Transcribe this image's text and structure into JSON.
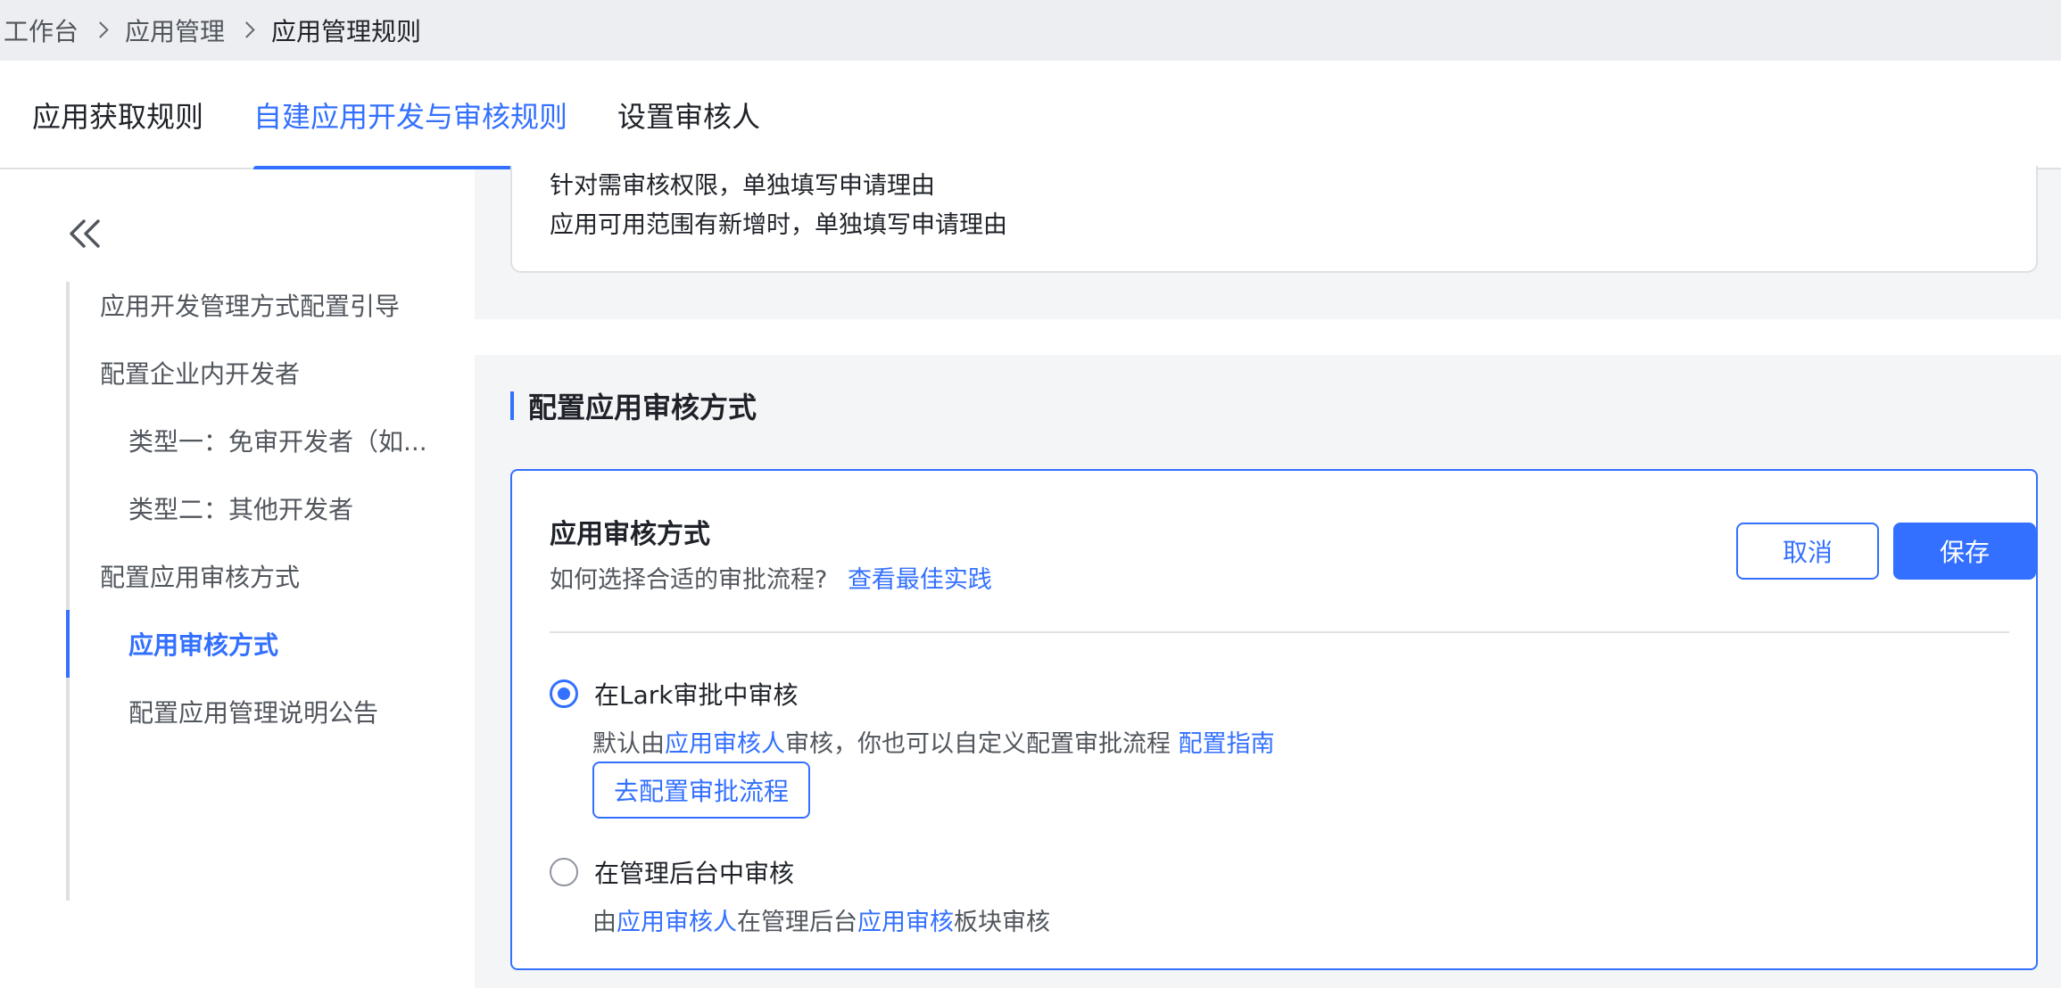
{
  "breadcrumb": {
    "items": [
      "工作台",
      "应用管理",
      "应用管理规则"
    ]
  },
  "tabs": [
    {
      "label": "应用获取规则",
      "active": false
    },
    {
      "label": "自建应用开发与审核规则",
      "active": true
    },
    {
      "label": "设置审核人",
      "active": false
    }
  ],
  "sidebar": {
    "collapse_icon": "double-chevron-left-icon",
    "items": [
      {
        "label": "应用开发管理方式配置引导",
        "level": 1,
        "active": false
      },
      {
        "label": "配置企业内开发者",
        "level": 1,
        "active": false
      },
      {
        "label": "类型一：免审开发者（如...",
        "level": 2,
        "active": false
      },
      {
        "label": "类型二：其他开发者",
        "level": 2,
        "active": false
      },
      {
        "label": "配置应用审核方式",
        "level": 1,
        "active": false
      },
      {
        "label": "应用审核方式",
        "level": 2,
        "active": true
      },
      {
        "label": "配置应用管理说明公告",
        "level": 2,
        "active": false
      }
    ]
  },
  "top_card": {
    "lines": [
      "针对需审核权限，单独填写申请理由",
      "应用可用范围有新增时，单独填写申请理由"
    ]
  },
  "section": {
    "title": "配置应用审核方式"
  },
  "card": {
    "title": "应用审核方式",
    "subtitle_text": "如何选择合适的审批流程?",
    "subtitle_link": "查看最佳实践",
    "cancel_label": "取消",
    "save_label": "保存",
    "options": [
      {
        "label": "在Lark审批中审核",
        "checked": true,
        "desc_prefix": "默认由",
        "desc_link1": "应用审核人",
        "desc_middle": "审核，你也可以自定义配置审批流程",
        "desc_link2": "配置指南",
        "button_label": "去配置审批流程"
      },
      {
        "label": "在管理后台中审核",
        "checked": false,
        "desc_prefix": "由",
        "desc_link1": "应用审核人",
        "desc_middle": "在管理后台",
        "desc_link2": "应用审核",
        "desc_suffix": "板块审核"
      }
    ]
  },
  "colors": {
    "accent": "#3370ff",
    "text": "#1f2329",
    "secondary_text": "#51565d",
    "border": "#dee0e3",
    "page_bg": "#f4f5f6"
  }
}
